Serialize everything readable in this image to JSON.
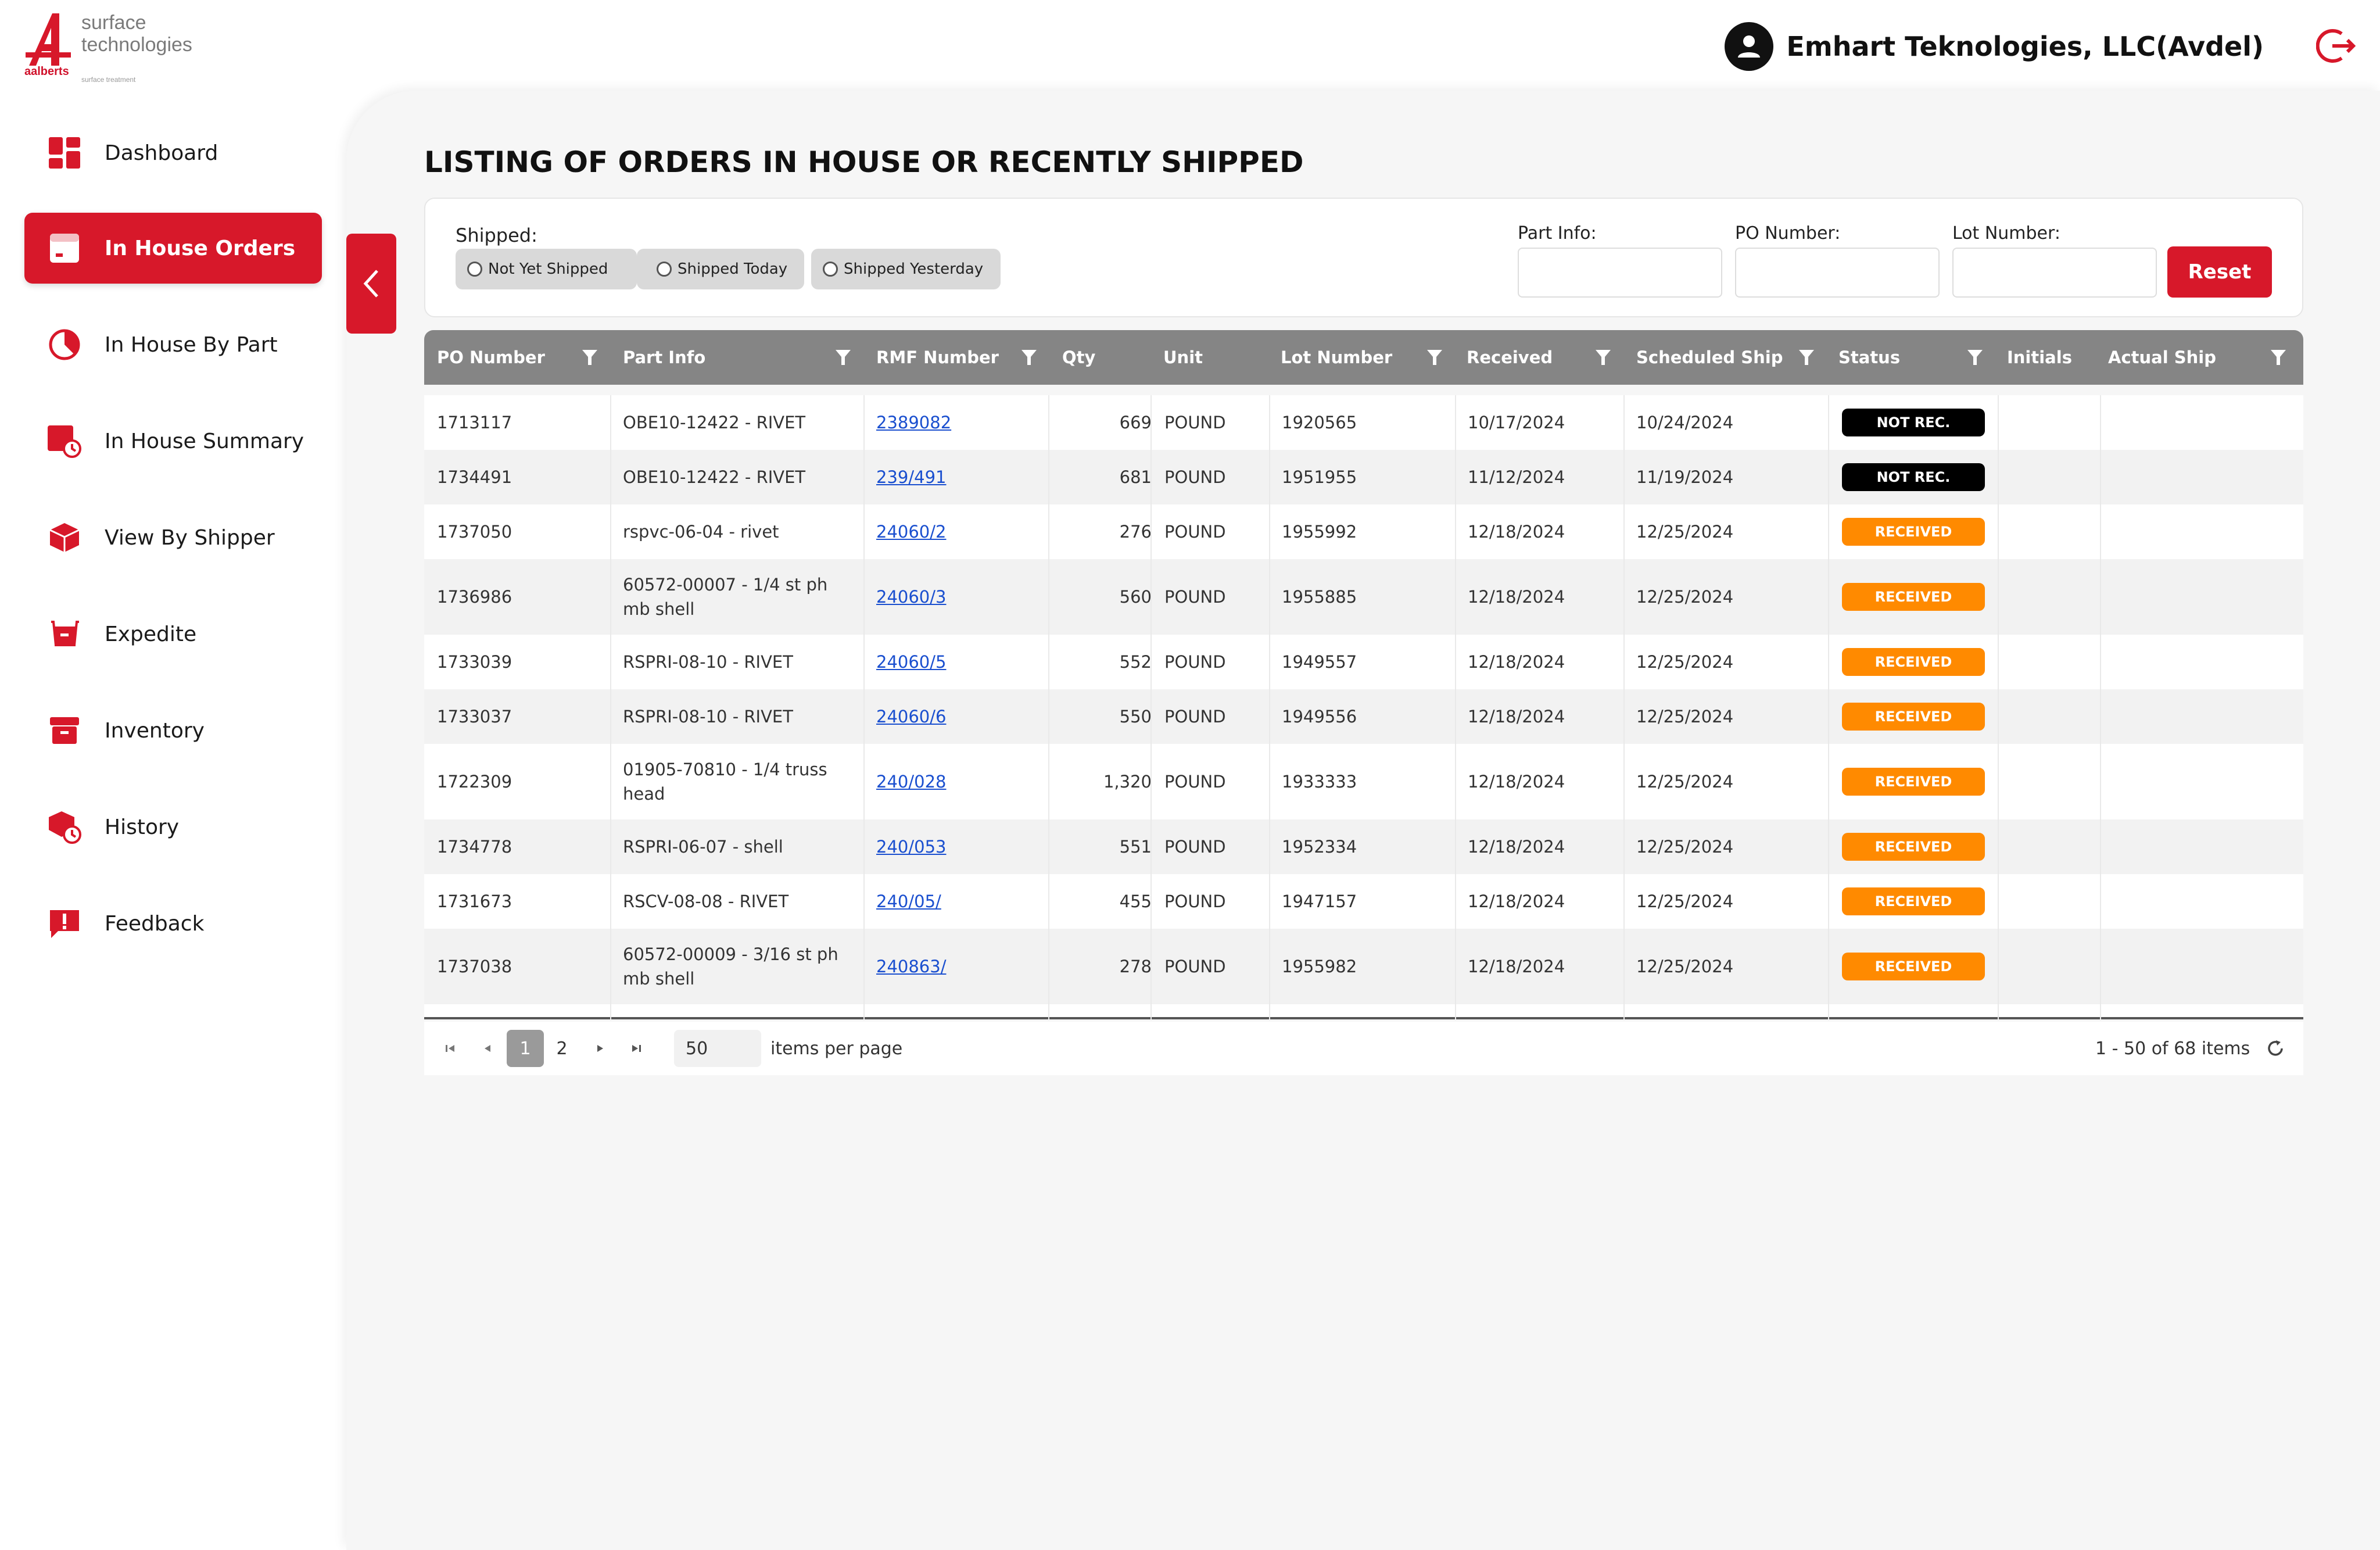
{
  "brand": {
    "name_line1": "surface",
    "name_line2": "technologies",
    "brand": "aalberts",
    "sub": "surface treatment",
    "color": "#d7182a"
  },
  "header": {
    "company": "Emhart Teknologies, LLC(Avdel)"
  },
  "sidebar": {
    "items": [
      {
        "label": "Dashboard",
        "icon": "dashboard-icon",
        "active": false
      },
      {
        "label": "In House Orders",
        "icon": "orders-icon",
        "active": true
      },
      {
        "label": "In House By Part",
        "icon": "pie-chart-icon",
        "active": false
      },
      {
        "label": "In House Summary",
        "icon": "summary-icon",
        "active": false
      },
      {
        "label": "View By Shipper",
        "icon": "box-icon",
        "active": false
      },
      {
        "label": "Expedite",
        "icon": "cart-icon",
        "active": false
      },
      {
        "label": "Inventory",
        "icon": "archive-icon",
        "active": false
      },
      {
        "label": "History",
        "icon": "history-icon",
        "active": false
      },
      {
        "label": "Feedback",
        "icon": "feedback-icon",
        "active": false
      }
    ]
  },
  "page": {
    "title": "LISTING OF ORDERS IN HOUSE OR RECENTLY SHIPPED"
  },
  "filters": {
    "shipped_label": "Shipped:",
    "shipped_options": [
      "Not Yet Shipped",
      "Shipped Today",
      "Shipped Yesterday"
    ],
    "part_info_label": "Part Info:",
    "po_number_label": "PO Number:",
    "lot_number_label": "Lot Number:",
    "part_info_value": "",
    "po_number_value": "",
    "lot_number_value": "",
    "reset_label": "Reset"
  },
  "table": {
    "columns": [
      "PO Number",
      "Part Info",
      "RMF Number",
      "Qty",
      "Unit",
      "Lot Number",
      "Received",
      "Scheduled Ship",
      "Status",
      "Initials",
      "Actual Ship"
    ],
    "rows": [
      {
        "po": "1713117",
        "part": "OBE10-12422 - RIVET",
        "rmf": "2389082",
        "qty": "669",
        "unit": "POUND",
        "lot": "1920565",
        "received": "10/17/2024",
        "sched": "10/24/2024",
        "status": "NOT REC.",
        "status_color": "black",
        "initials": "",
        "actual": ""
      },
      {
        "po": "1734491",
        "part": "OBE10-12422 - RIVET",
        "rmf": "239/491",
        "qty": "681",
        "unit": "POUND",
        "lot": "1951955",
        "received": "11/12/2024",
        "sched": "11/19/2024",
        "status": "NOT REC.",
        "status_color": "black",
        "initials": "",
        "actual": ""
      },
      {
        "po": "1737050",
        "part": "rspvc-06-04 - rivet",
        "rmf": "24060/2",
        "qty": "276",
        "unit": "POUND",
        "lot": "1955992",
        "received": "12/18/2024",
        "sched": "12/25/2024",
        "status": "RECEIVED",
        "status_color": "orange",
        "initials": "",
        "actual": ""
      },
      {
        "po": "1736986",
        "part": "60572-00007 - 1/4 st ph mb shell",
        "rmf": "24060/3",
        "qty": "560",
        "unit": "POUND",
        "lot": "1955885",
        "received": "12/18/2024",
        "sched": "12/25/2024",
        "status": "RECEIVED",
        "status_color": "orange",
        "initials": "",
        "actual": ""
      },
      {
        "po": "1733039",
        "part": "RSPRI-08-10 - RIVET",
        "rmf": "24060/5",
        "qty": "552",
        "unit": "POUND",
        "lot": "1949557",
        "received": "12/18/2024",
        "sched": "12/25/2024",
        "status": "RECEIVED",
        "status_color": "orange",
        "initials": "",
        "actual": ""
      },
      {
        "po": "1733037",
        "part": "RSPRI-08-10 - RIVET",
        "rmf": "24060/6",
        "qty": "550",
        "unit": "POUND",
        "lot": "1949556",
        "received": "12/18/2024",
        "sched": "12/25/2024",
        "status": "RECEIVED",
        "status_color": "orange",
        "initials": "",
        "actual": ""
      },
      {
        "po": "1722309",
        "part": "01905-70810 - 1/4 truss head",
        "rmf": "240/028",
        "qty": "1,320",
        "unit": "POUND",
        "lot": "1933333",
        "received": "12/18/2024",
        "sched": "12/25/2024",
        "status": "RECEIVED",
        "status_color": "orange",
        "initials": "",
        "actual": ""
      },
      {
        "po": "1734778",
        "part": "RSPRI-06-07 - shell",
        "rmf": "240/053",
        "qty": "551",
        "unit": "POUND",
        "lot": "1952334",
        "received": "12/18/2024",
        "sched": "12/25/2024",
        "status": "RECEIVED",
        "status_color": "orange",
        "initials": "",
        "actual": ""
      },
      {
        "po": "1731673",
        "part": "RSCV-08-08 - RIVET",
        "rmf": "240/05/",
        "qty": "455",
        "unit": "POUND",
        "lot": "1947157",
        "received": "12/18/2024",
        "sched": "12/25/2024",
        "status": "RECEIVED",
        "status_color": "orange",
        "initials": "",
        "actual": ""
      },
      {
        "po": "1737038",
        "part": "60572-00009 - 3/16 st ph mb shell",
        "rmf": "240863/",
        "qty": "278",
        "unit": "POUND",
        "lot": "1955982",
        "received": "12/18/2024",
        "sched": "12/25/2024",
        "status": "RECEIVED",
        "status_color": "orange",
        "initials": "",
        "actual": ""
      }
    ]
  },
  "pager": {
    "pages": [
      "1",
      "2"
    ],
    "current": "1",
    "page_size": "50",
    "per_page_label": "items per page",
    "summary": "1 - 50 of 68 items"
  }
}
